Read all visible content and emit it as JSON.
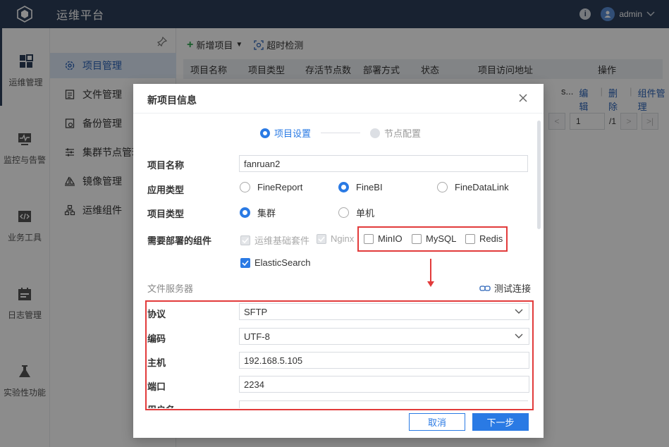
{
  "app": {
    "title": "运维平台",
    "user": "admin"
  },
  "rail": [
    {
      "label": "运维管理"
    },
    {
      "label": "监控与告警"
    },
    {
      "label": "业务工具"
    },
    {
      "label": "日志管理"
    },
    {
      "label": "实验性功能"
    }
  ],
  "subnav": [
    {
      "label": "项目管理"
    },
    {
      "label": "文件管理"
    },
    {
      "label": "备份管理"
    },
    {
      "label": "集群节点管理"
    },
    {
      "label": "镜像管理"
    },
    {
      "label": "运维组件"
    }
  ],
  "toolbar": {
    "add": "新增项目",
    "timeout": "超时检测"
  },
  "table": {
    "headers": [
      "项目名称",
      "项目类型",
      "存活节点数",
      "部署方式",
      "状态",
      "项目访问地址",
      "操作"
    ],
    "row_partial": "s...",
    "actions": [
      "编辑",
      "删除",
      "组件管理"
    ]
  },
  "pager": {
    "page": "1",
    "total": "/1"
  },
  "modal": {
    "title": "新项目信息",
    "steps": [
      "项目设置",
      "节点配置"
    ],
    "name_label": "项目名称",
    "name_value": "fanruan2",
    "app_type_label": "应用类型",
    "app_types": [
      "FineReport",
      "FineBI",
      "FineDataLink"
    ],
    "project_type_label": "项目类型",
    "project_types": [
      "集群",
      "单机"
    ],
    "components_label": "需要部署的组件",
    "components": [
      "运维基础套件",
      "Nginx",
      "MinIO",
      "MySQL",
      "Redis",
      "ElasticSearch"
    ],
    "file_server_title": "文件服务器",
    "test_conn": "测试连接",
    "protocol_label": "协议",
    "protocol_value": "SFTP",
    "encoding_label": "编码",
    "encoding_value": "UTF-8",
    "host_label": "主机",
    "host_value": "192.168.5.105",
    "port_label": "端口",
    "port_value": "2234",
    "username_label": "用户名",
    "cancel": "取消",
    "next": "下一步"
  },
  "colors": {
    "accent": "#2a7ae4",
    "topbar": "#2c3e5a",
    "highlight": "#e23b3b"
  }
}
